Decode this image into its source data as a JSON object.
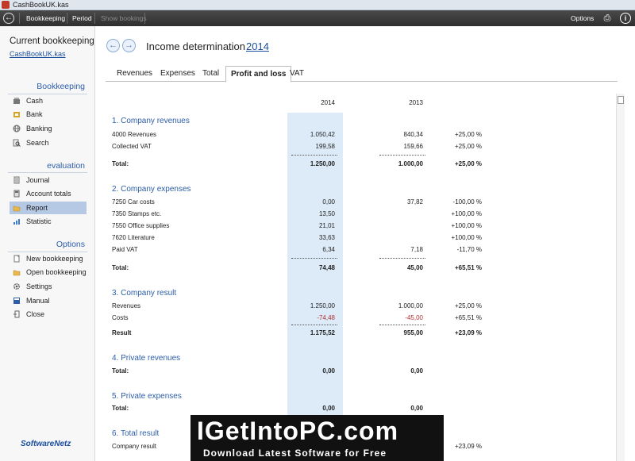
{
  "window": {
    "title": "CashBookUK.kas"
  },
  "toolbar": {
    "items": [
      {
        "label": "Bookkeeping"
      },
      {
        "label": "Period"
      },
      {
        "label": "Show bookings"
      }
    ],
    "options_label": "Options"
  },
  "sidebar": {
    "current_label": "Current bookkeeping",
    "file_name": "CashBookUK.kas",
    "sections": [
      {
        "title": "Bookkeeping",
        "items": [
          "Cash",
          "Bank",
          "Banking",
          "Search"
        ]
      },
      {
        "title": "evaluation",
        "items": [
          "Journal",
          "Account totals",
          "Report",
          "Statistic"
        ]
      },
      {
        "title": "Options",
        "items": [
          "New bookkeeping",
          "Open bookkeeping",
          "Settings",
          "Manual",
          "Close"
        ]
      }
    ],
    "active_item": "Report",
    "logo": "SoftwareNetz"
  },
  "page": {
    "title": "Income determination",
    "year": "2014",
    "tabs": [
      "Revenues",
      "Expenses",
      "Total",
      "Profit and loss",
      "VAT"
    ],
    "active_tab": "Profit and loss"
  },
  "report": {
    "col_headers": [
      "2014",
      "2013"
    ],
    "sections": [
      {
        "title": "1. Company revenues",
        "rows": [
          {
            "label": "4000 Revenues",
            "v1": "1.050,42",
            "v2": "840,34",
            "pct": "+25,00 %"
          },
          {
            "label": "Collected VAT",
            "v1": "199,58",
            "v2": "159,66",
            "pct": "+25,00 %"
          }
        ],
        "total": {
          "label": "Total:",
          "v1": "1.250,00",
          "v2": "1.000,00",
          "pct": "+25,00 %"
        }
      },
      {
        "title": "2. Company expenses",
        "rows": [
          {
            "label": "7250 Car costs",
            "v1": "0,00",
            "v2": "37,82",
            "pct": "-100,00 %"
          },
          {
            "label": "7350 Stamps etc.",
            "v1": "13,50",
            "v2": "",
            "pct": "+100,00 %"
          },
          {
            "label": "7550 Office supplies",
            "v1": "21,01",
            "v2": "",
            "pct": "+100,00 %"
          },
          {
            "label": "7620 Literature",
            "v1": "33,63",
            "v2": "",
            "pct": "+100,00 %"
          },
          {
            "label": "Paid VAT",
            "v1": "6,34",
            "v2": "7,18",
            "pct": "-11,70 %"
          }
        ],
        "total": {
          "label": "Total:",
          "v1": "74,48",
          "v2": "45,00",
          "pct": "+65,51 %"
        }
      },
      {
        "title": "3. Company result",
        "rows": [
          {
            "label": "Revenues",
            "v1": "1.250,00",
            "v2": "1.000,00",
            "pct": "+25,00 %"
          },
          {
            "label": "Costs",
            "v1": "-74,48",
            "v2": "-45,00",
            "pct": "+65,51 %"
          }
        ],
        "total": {
          "label": "Result",
          "v1": "1.175,52",
          "v2": "955,00",
          "pct": "+23,09 %"
        }
      },
      {
        "title": "4. Private revenues",
        "rows": [],
        "total": {
          "label": "Total:",
          "v1": "0,00",
          "v2": "0,00",
          "pct": ""
        }
      },
      {
        "title": "5. Private expenses",
        "rows": [],
        "total": {
          "label": "Total:",
          "v1": "0,00",
          "v2": "0,00",
          "pct": ""
        }
      },
      {
        "title": "6. Total result",
        "rows": [
          {
            "label": "Company result",
            "v1": "",
            "v2": "",
            "pct": "+23,09 %"
          }
        ],
        "total": null
      }
    ]
  },
  "banner": {
    "headline": "IGetIntoPC.com",
    "tagline": "Download Latest Software for Free"
  }
}
